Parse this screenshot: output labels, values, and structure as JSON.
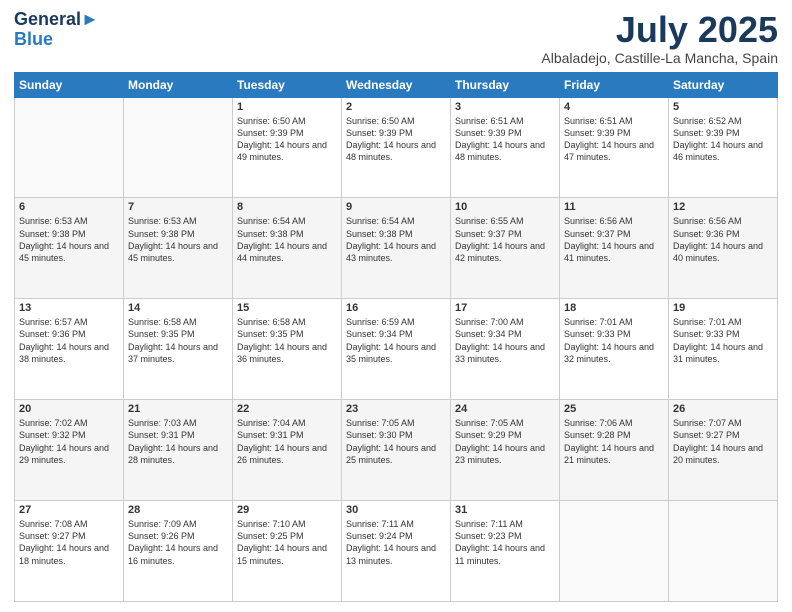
{
  "header": {
    "logo_line1": "General",
    "logo_line2": "Blue",
    "month": "July 2025",
    "location": "Albaladejo, Castille-La Mancha, Spain"
  },
  "days_of_week": [
    "Sunday",
    "Monday",
    "Tuesday",
    "Wednesday",
    "Thursday",
    "Friday",
    "Saturday"
  ],
  "weeks": [
    [
      {
        "day": "",
        "sunrise": "",
        "sunset": "",
        "daylight": ""
      },
      {
        "day": "",
        "sunrise": "",
        "sunset": "",
        "daylight": ""
      },
      {
        "day": "1",
        "sunrise": "Sunrise: 6:50 AM",
        "sunset": "Sunset: 9:39 PM",
        "daylight": "Daylight: 14 hours and 49 minutes."
      },
      {
        "day": "2",
        "sunrise": "Sunrise: 6:50 AM",
        "sunset": "Sunset: 9:39 PM",
        "daylight": "Daylight: 14 hours and 48 minutes."
      },
      {
        "day": "3",
        "sunrise": "Sunrise: 6:51 AM",
        "sunset": "Sunset: 9:39 PM",
        "daylight": "Daylight: 14 hours and 48 minutes."
      },
      {
        "day": "4",
        "sunrise": "Sunrise: 6:51 AM",
        "sunset": "Sunset: 9:39 PM",
        "daylight": "Daylight: 14 hours and 47 minutes."
      },
      {
        "day": "5",
        "sunrise": "Sunrise: 6:52 AM",
        "sunset": "Sunset: 9:39 PM",
        "daylight": "Daylight: 14 hours and 46 minutes."
      }
    ],
    [
      {
        "day": "6",
        "sunrise": "Sunrise: 6:53 AM",
        "sunset": "Sunset: 9:38 PM",
        "daylight": "Daylight: 14 hours and 45 minutes."
      },
      {
        "day": "7",
        "sunrise": "Sunrise: 6:53 AM",
        "sunset": "Sunset: 9:38 PM",
        "daylight": "Daylight: 14 hours and 45 minutes."
      },
      {
        "day": "8",
        "sunrise": "Sunrise: 6:54 AM",
        "sunset": "Sunset: 9:38 PM",
        "daylight": "Daylight: 14 hours and 44 minutes."
      },
      {
        "day": "9",
        "sunrise": "Sunrise: 6:54 AM",
        "sunset": "Sunset: 9:38 PM",
        "daylight": "Daylight: 14 hours and 43 minutes."
      },
      {
        "day": "10",
        "sunrise": "Sunrise: 6:55 AM",
        "sunset": "Sunset: 9:37 PM",
        "daylight": "Daylight: 14 hours and 42 minutes."
      },
      {
        "day": "11",
        "sunrise": "Sunrise: 6:56 AM",
        "sunset": "Sunset: 9:37 PM",
        "daylight": "Daylight: 14 hours and 41 minutes."
      },
      {
        "day": "12",
        "sunrise": "Sunrise: 6:56 AM",
        "sunset": "Sunset: 9:36 PM",
        "daylight": "Daylight: 14 hours and 40 minutes."
      }
    ],
    [
      {
        "day": "13",
        "sunrise": "Sunrise: 6:57 AM",
        "sunset": "Sunset: 9:36 PM",
        "daylight": "Daylight: 14 hours and 38 minutes."
      },
      {
        "day": "14",
        "sunrise": "Sunrise: 6:58 AM",
        "sunset": "Sunset: 9:35 PM",
        "daylight": "Daylight: 14 hours and 37 minutes."
      },
      {
        "day": "15",
        "sunrise": "Sunrise: 6:58 AM",
        "sunset": "Sunset: 9:35 PM",
        "daylight": "Daylight: 14 hours and 36 minutes."
      },
      {
        "day": "16",
        "sunrise": "Sunrise: 6:59 AM",
        "sunset": "Sunset: 9:34 PM",
        "daylight": "Daylight: 14 hours and 35 minutes."
      },
      {
        "day": "17",
        "sunrise": "Sunrise: 7:00 AM",
        "sunset": "Sunset: 9:34 PM",
        "daylight": "Daylight: 14 hours and 33 minutes."
      },
      {
        "day": "18",
        "sunrise": "Sunrise: 7:01 AM",
        "sunset": "Sunset: 9:33 PM",
        "daylight": "Daylight: 14 hours and 32 minutes."
      },
      {
        "day": "19",
        "sunrise": "Sunrise: 7:01 AM",
        "sunset": "Sunset: 9:33 PM",
        "daylight": "Daylight: 14 hours and 31 minutes."
      }
    ],
    [
      {
        "day": "20",
        "sunrise": "Sunrise: 7:02 AM",
        "sunset": "Sunset: 9:32 PM",
        "daylight": "Daylight: 14 hours and 29 minutes."
      },
      {
        "day": "21",
        "sunrise": "Sunrise: 7:03 AM",
        "sunset": "Sunset: 9:31 PM",
        "daylight": "Daylight: 14 hours and 28 minutes."
      },
      {
        "day": "22",
        "sunrise": "Sunrise: 7:04 AM",
        "sunset": "Sunset: 9:31 PM",
        "daylight": "Daylight: 14 hours and 26 minutes."
      },
      {
        "day": "23",
        "sunrise": "Sunrise: 7:05 AM",
        "sunset": "Sunset: 9:30 PM",
        "daylight": "Daylight: 14 hours and 25 minutes."
      },
      {
        "day": "24",
        "sunrise": "Sunrise: 7:05 AM",
        "sunset": "Sunset: 9:29 PM",
        "daylight": "Daylight: 14 hours and 23 minutes."
      },
      {
        "day": "25",
        "sunrise": "Sunrise: 7:06 AM",
        "sunset": "Sunset: 9:28 PM",
        "daylight": "Daylight: 14 hours and 21 minutes."
      },
      {
        "day": "26",
        "sunrise": "Sunrise: 7:07 AM",
        "sunset": "Sunset: 9:27 PM",
        "daylight": "Daylight: 14 hours and 20 minutes."
      }
    ],
    [
      {
        "day": "27",
        "sunrise": "Sunrise: 7:08 AM",
        "sunset": "Sunset: 9:27 PM",
        "daylight": "Daylight: 14 hours and 18 minutes."
      },
      {
        "day": "28",
        "sunrise": "Sunrise: 7:09 AM",
        "sunset": "Sunset: 9:26 PM",
        "daylight": "Daylight: 14 hours and 16 minutes."
      },
      {
        "day": "29",
        "sunrise": "Sunrise: 7:10 AM",
        "sunset": "Sunset: 9:25 PM",
        "daylight": "Daylight: 14 hours and 15 minutes."
      },
      {
        "day": "30",
        "sunrise": "Sunrise: 7:11 AM",
        "sunset": "Sunset: 9:24 PM",
        "daylight": "Daylight: 14 hours and 13 minutes."
      },
      {
        "day": "31",
        "sunrise": "Sunrise: 7:11 AM",
        "sunset": "Sunset: 9:23 PM",
        "daylight": "Daylight: 14 hours and 11 minutes."
      },
      {
        "day": "",
        "sunrise": "",
        "sunset": "",
        "daylight": ""
      },
      {
        "day": "",
        "sunrise": "",
        "sunset": "",
        "daylight": ""
      }
    ]
  ]
}
